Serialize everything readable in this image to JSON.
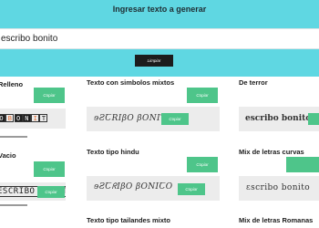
{
  "header": {
    "title": "Ingresar texto a generar",
    "input_value": "escribo bonito",
    "clear_label": "Limpiar"
  },
  "copy_label": "Copiar",
  "cards": {
    "relleno": {
      "title": "Relleno",
      "letters": [
        "O",
        "B",
        "O",
        "N",
        "I",
        "T"
      ]
    },
    "vacio": {
      "title": "Vacio",
      "text": "ESCRIBO BONITO"
    },
    "simbolos": {
      "title": "Texto con simbolos mixtos",
      "text": "ɘƧꞆRIβO βONITO"
    },
    "hindu": {
      "title": "Texto tipo hindu",
      "text": "ɘƧꞆᖇIβO βONIꞆO"
    },
    "tailandes": {
      "title": "Texto tipo tailandes mixto"
    },
    "terror": {
      "title": "De terror",
      "text": "escribo bonito"
    },
    "curvas": {
      "title": "Mix de letras curvas",
      "text": "ɛscribo bonito"
    },
    "romanas": {
      "title": "Mix de letras Romanas"
    }
  }
}
